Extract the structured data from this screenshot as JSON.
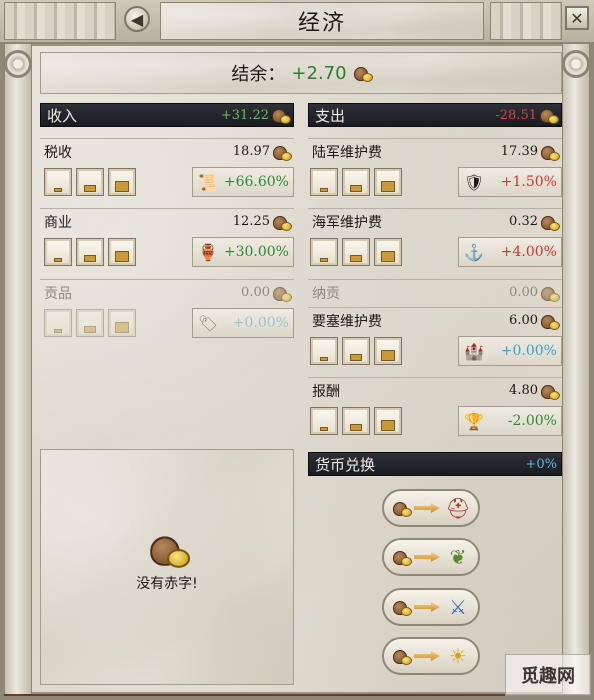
{
  "window": {
    "title": "经济",
    "back_glyph": "◀",
    "close_glyph": "✕"
  },
  "balance": {
    "label": "结余：",
    "value": "+2.70"
  },
  "income": {
    "header": "收入",
    "total": "+31.22",
    "rows": [
      {
        "label": "税收",
        "amount": "18.97",
        "effect": "+66.60%",
        "icon": "tax-scroll-icon",
        "effect_color": "green",
        "enabled": true
      },
      {
        "label": "商业",
        "amount": "12.25",
        "effect": "+30.00%",
        "icon": "trade-goods-icon",
        "effect_color": "green",
        "enabled": true
      },
      {
        "label": "贡品",
        "amount": "0.00",
        "effect": "+0.00%",
        "icon": "tribute-icon",
        "effect_color": "blue",
        "enabled": false
      }
    ]
  },
  "expense": {
    "header": "支出",
    "total": "-28.51",
    "rows": [
      {
        "label": "陆军维护费",
        "amount": "17.39",
        "effect": "+1.50%",
        "icon": "soldier-icon",
        "effect_color": "red",
        "enabled": true,
        "buttons": true
      },
      {
        "label": "海军维护费",
        "amount": "0.32",
        "effect": "+4.00%",
        "icon": "anchor-icon",
        "effect_color": "red",
        "enabled": true,
        "buttons": true
      },
      {
        "label": "纳贡",
        "amount": "0.00",
        "effect": "",
        "icon": "",
        "effect_color": "",
        "enabled": false,
        "buttons": false
      },
      {
        "label": "要塞维护费",
        "amount": "6.00",
        "effect": "+0.00%",
        "icon": "fort-icon",
        "effect_color": "blue",
        "enabled": true,
        "buttons": true
      },
      {
        "label": "报酬",
        "amount": "4.80",
        "effect": "-2.00%",
        "icon": "reward-icon",
        "effect_color": "green",
        "enabled": true,
        "buttons": true
      }
    ]
  },
  "deficit": {
    "message": "没有赤字!"
  },
  "exchange": {
    "header": "货币兑换",
    "value": "+0%",
    "options": [
      {
        "target_icon": "legion-helmet-icon",
        "glyph": "⛑"
      },
      {
        "target_icon": "laurel-wreath-icon",
        "glyph": "❦"
      },
      {
        "target_icon": "sword-scroll-icon",
        "glyph": "⚔"
      },
      {
        "target_icon": "sun-icon",
        "glyph": "☀"
      }
    ]
  },
  "colors": {
    "positive": "#2f8a35",
    "negative": "#d0332e",
    "neutral": "#3a9fcf",
    "header_bg": "#1b1c22"
  },
  "watermark": "觅趣网"
}
